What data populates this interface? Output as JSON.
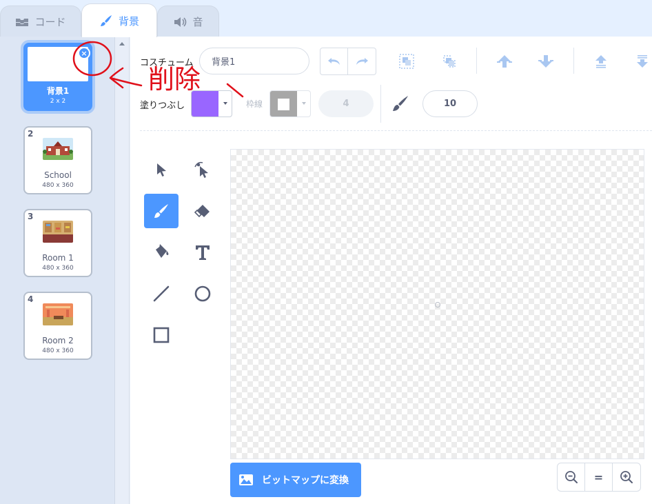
{
  "tabs": [
    {
      "label": "コード",
      "icon": "code-icon"
    },
    {
      "label": "背景",
      "icon": "paintbrush-icon"
    },
    {
      "label": "音",
      "icon": "speaker-icon"
    }
  ],
  "backdrops": [
    {
      "number": "1",
      "name": "背景1",
      "size": "2 x 2",
      "selected": true
    },
    {
      "number": "2",
      "name": "School",
      "size": "480 x 360"
    },
    {
      "number": "3",
      "name": "Room 1",
      "size": "480 x 360"
    },
    {
      "number": "4",
      "name": "Room 2",
      "size": "480 x 360"
    }
  ],
  "toolbar": {
    "costume_label": "コスチューム",
    "costume_name": "背景1",
    "fill_label": "塗りつぶし",
    "outline_label": "枠線",
    "outline_width": "4",
    "brush_size": "10"
  },
  "colors": {
    "accent": "#4c97ff",
    "fill": "#9966ff",
    "outline": "#9e9e9e",
    "annotation": "#e0101a"
  },
  "convert_button": "ビットマップに変換",
  "zoom": {
    "reset_label": "="
  },
  "annotation": {
    "text": "削除"
  }
}
